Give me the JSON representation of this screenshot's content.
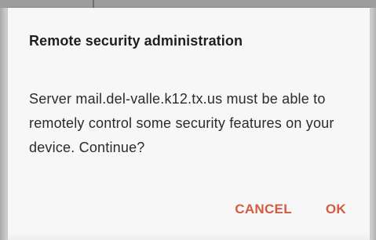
{
  "dialog": {
    "title": "Remote security administration",
    "message": "Server mail.del-valle.k12.tx.us must be able to remotely control some security features on your device. Continue?",
    "buttons": {
      "cancel_label": "CANCEL",
      "ok_label": "OK"
    },
    "accent_color": "#d45b40"
  }
}
